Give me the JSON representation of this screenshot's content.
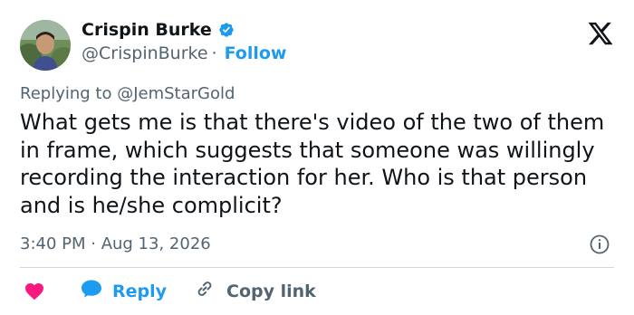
{
  "author": {
    "name": "Crispin Burke",
    "handle": "@CrispinBurke",
    "separator": "·",
    "follow_label": "Follow",
    "avatar_icon": "user-avatar",
    "verified_icon": "verified-badge-icon"
  },
  "platform": {
    "logo_icon": "x-logo-icon"
  },
  "reply_context": {
    "prefix": "Replying to",
    "mention": "@JemStarGold"
  },
  "tweet": {
    "text": "What gets me is that there's video of the two of them in frame, which suggests that someone was willingly recording the interaction for her. Who is that person and is he/she complicit?",
    "timestamp": "3:40 PM · Aug 13, 2026"
  },
  "actions": {
    "like_icon": "heart-icon",
    "reply_label": "Reply",
    "reply_icon": "reply-bubble-icon",
    "copy_link_label": "Copy link",
    "copy_link_icon": "link-icon",
    "info_icon": "info-icon"
  },
  "colors": {
    "accent": "#1d9bf0",
    "like": "#f91880",
    "text": "#0f1419",
    "secondary": "#536471"
  }
}
